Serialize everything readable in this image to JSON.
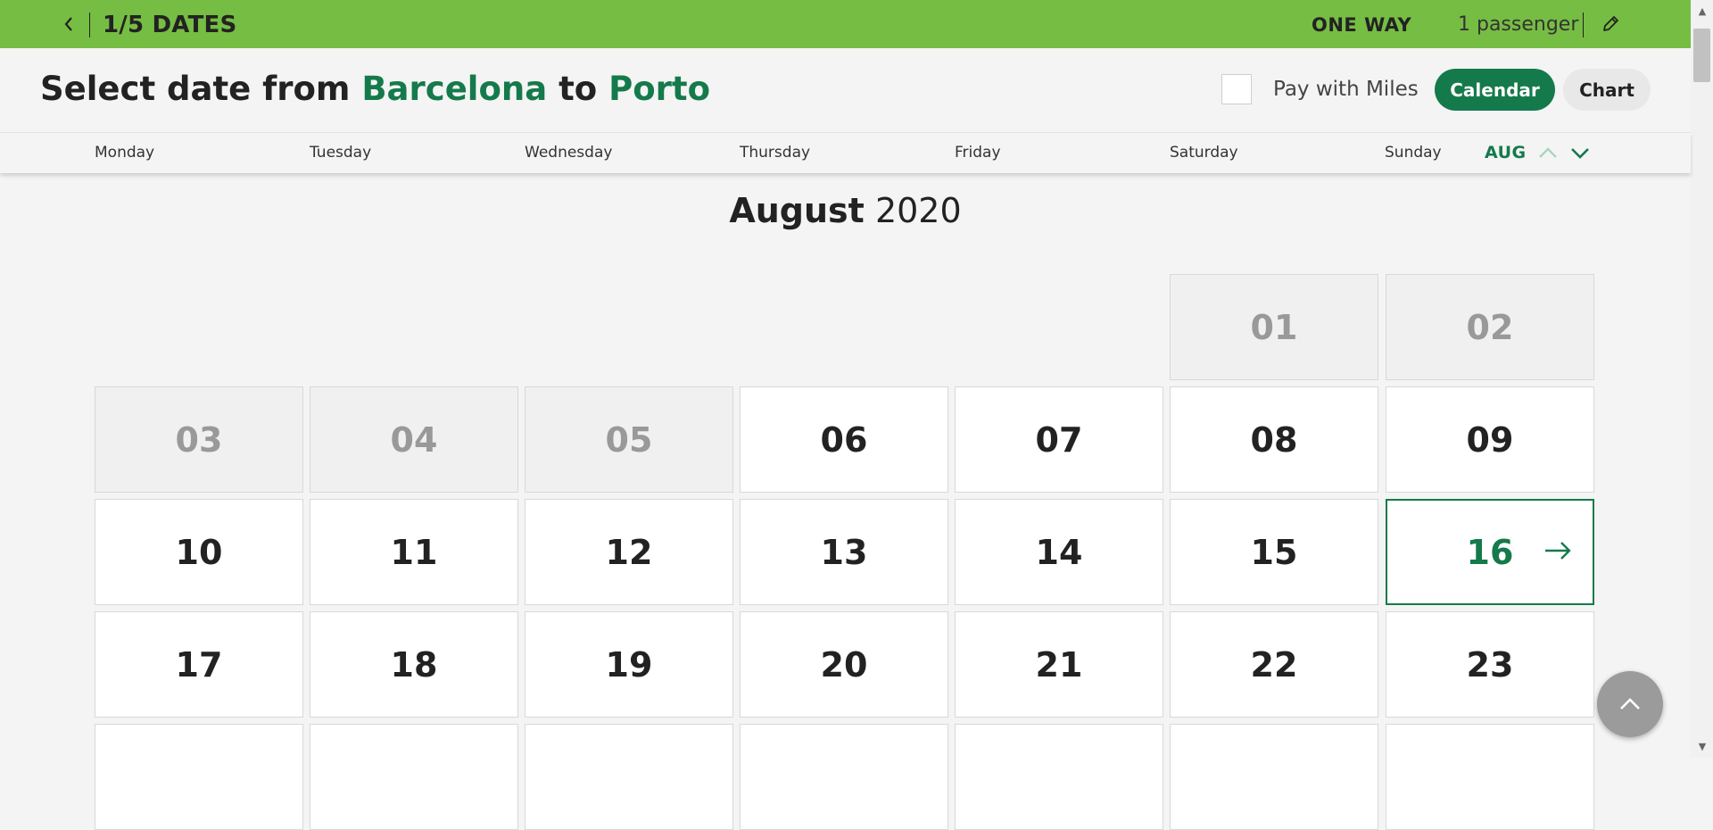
{
  "topbar": {
    "step_label": "1/5 DATES",
    "trip_type": "ONE WAY",
    "passengers": "1 passenger",
    "color": "#76bd43"
  },
  "header": {
    "title_prefix": "Select date from",
    "origin": "Barcelona",
    "title_connector": "to",
    "destination": "Porto",
    "pay_with_miles_label": "Pay with Miles",
    "pay_with_miles_checked": false,
    "calendar_button": "Calendar",
    "chart_button": "Chart",
    "accent_color": "#157a4b"
  },
  "weekdays": [
    "Monday",
    "Tuesday",
    "Wednesday",
    "Thursday",
    "Friday",
    "Saturday",
    "Sunday"
  ],
  "month_nav": {
    "label": "AUG"
  },
  "calendar": {
    "month": "August",
    "year": "2020",
    "selected_day": "16",
    "days": [
      {
        "day": "01",
        "disabled": true
      },
      {
        "day": "02",
        "disabled": true
      },
      {
        "day": "03",
        "disabled": true
      },
      {
        "day": "04",
        "disabled": true
      },
      {
        "day": "05",
        "disabled": true
      },
      {
        "day": "06",
        "disabled": false
      },
      {
        "day": "07",
        "disabled": false
      },
      {
        "day": "08",
        "disabled": false
      },
      {
        "day": "09",
        "disabled": false
      },
      {
        "day": "10",
        "disabled": false
      },
      {
        "day": "11",
        "disabled": false
      },
      {
        "day": "12",
        "disabled": false
      },
      {
        "day": "13",
        "disabled": false
      },
      {
        "day": "14",
        "disabled": false
      },
      {
        "day": "15",
        "disabled": false
      },
      {
        "day": "16",
        "disabled": false
      },
      {
        "day": "17",
        "disabled": false
      },
      {
        "day": "18",
        "disabled": false
      },
      {
        "day": "19",
        "disabled": false
      },
      {
        "day": "20",
        "disabled": false
      },
      {
        "day": "21",
        "disabled": false
      },
      {
        "day": "22",
        "disabled": false
      },
      {
        "day": "23",
        "disabled": false
      },
      {
        "day": "",
        "disabled": false
      },
      {
        "day": "",
        "disabled": false
      },
      {
        "day": "",
        "disabled": false
      },
      {
        "day": "",
        "disabled": false
      },
      {
        "day": "",
        "disabled": false
      },
      {
        "day": "",
        "disabled": false
      },
      {
        "day": "",
        "disabled": false
      }
    ]
  },
  "icons": {
    "back": "chevron-left-icon",
    "edit": "pencil-icon",
    "month_prev": "chevron-up-icon",
    "month_next": "chevron-down-icon",
    "selected_arrow": "arrow-right-icon",
    "to_top": "chevron-up-icon"
  }
}
